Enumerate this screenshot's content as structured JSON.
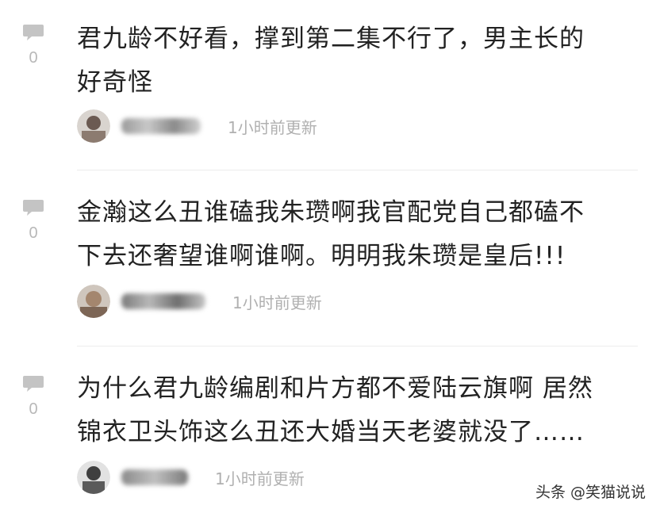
{
  "comments": [
    {
      "likes": "0",
      "text": "君九龄不好看，撑到第二集不行了，男主长的\n好奇怪",
      "timestamp": "1小时前更新"
    },
    {
      "likes": "0",
      "text": "金瀚这么丑谁磕我朱瓒啊我官配党自己都磕不\n下去还奢望谁啊谁啊。明明我朱瓒是皇后!!!",
      "timestamp": "1小时前更新"
    },
    {
      "likes": "0",
      "text": "为什么君九龄编剧和片方都不爱陆云旗啊 居然\n锦衣卫头饰这么丑还大婚当天老婆就没了……",
      "timestamp": "1小时前更新"
    }
  ],
  "watermark": "头条 @笑猫说说",
  "colors": {
    "text": "#222222",
    "meta": "#b0b0b0",
    "icon": "#c4c4c4",
    "divider": "#ececec"
  }
}
